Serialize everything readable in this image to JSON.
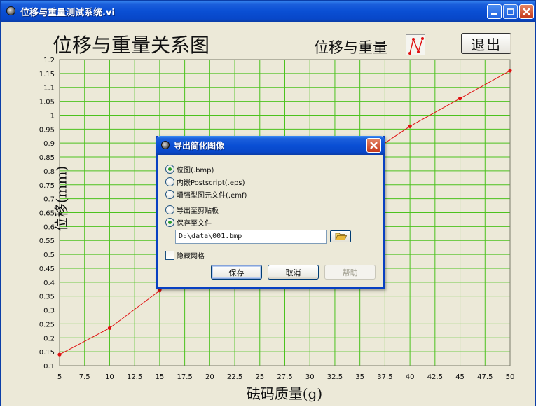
{
  "window": {
    "title": "位移与重量测试系统.vi"
  },
  "panel": {
    "chart_title": "位移与重量关系图",
    "legend_label": "位移与重量",
    "exit_button": "退出",
    "y_axis_label": "位移(mm)",
    "x_axis_label": "砝码质量(g)"
  },
  "colors": {
    "plot_background": "#ece9d8",
    "grid": "#4cc21e",
    "series": "#e01010",
    "titlebar": "#0a4fd4"
  },
  "chart_data": {
    "type": "line",
    "title": "位移与重量关系图",
    "xlabel": "砝码质量(g)",
    "ylabel": "位移(mm)",
    "xlim": [
      5,
      50
    ],
    "ylim": [
      0.1,
      1.2
    ],
    "grid": true,
    "legend": "top-right",
    "x_ticks": [
      "5",
      "7.5",
      "10",
      "12.5",
      "15",
      "17.5",
      "20",
      "22.5",
      "25",
      "27.5",
      "30",
      "32.5",
      "35",
      "37.5",
      "40",
      "42.5",
      "45",
      "47.5",
      "50"
    ],
    "y_ticks": [
      "0.1",
      "0.15",
      "0.2",
      "0.25",
      "0.3",
      "0.35",
      "0.4",
      "0.45",
      "0.5",
      "0.55",
      "0.6",
      "0.65",
      "0.7",
      "0.75",
      "0.8",
      "0.85",
      "0.9",
      "0.95",
      "1",
      "1.05",
      "1.1",
      "1.15",
      "1.2"
    ],
    "series": [
      {
        "name": "位移与重量",
        "x": [
          5,
          10,
          15,
          20,
          25,
          30,
          35,
          40,
          45,
          50
        ],
        "y": [
          0.14,
          0.235,
          0.37,
          0.49,
          0.61,
          0.725,
          0.84,
          0.96,
          1.06,
          1.16
        ]
      }
    ]
  },
  "dialog": {
    "title": "导出简化图像",
    "options": [
      {
        "label": "位图(.bmp)",
        "checked": true
      },
      {
        "label": "内嵌Postscript(.eps)",
        "checked": false
      },
      {
        "label": "增强型图元文件(.emf)",
        "checked": false
      },
      {
        "label": "导出至剪贴板",
        "checked": false
      },
      {
        "label": "保存至文件",
        "checked": true
      }
    ],
    "file_path": "D:\\data\\001.bmp",
    "hide_grid_label": "隐藏网格",
    "hide_grid_checked": false,
    "save_button": "保存",
    "cancel_button": "取消",
    "help_button": "帮助"
  }
}
